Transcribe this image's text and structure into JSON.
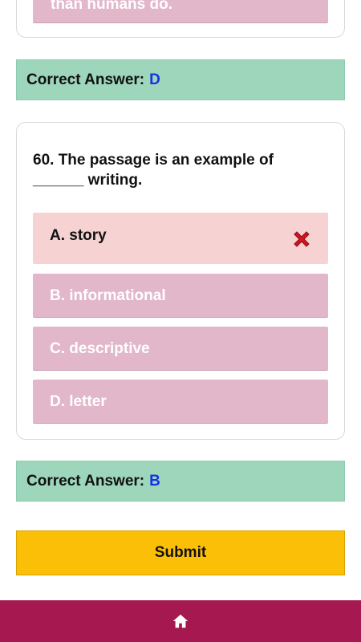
{
  "previous_question": {
    "option_partial_text": "than humans do."
  },
  "answer_bars": [
    {
      "label": "Correct Answer:",
      "letter": "D"
    },
    {
      "label": "Correct Answer:",
      "letter": "B"
    }
  ],
  "question": {
    "text_line1": "60. The passage is an example of",
    "text_line2": "______ writing.",
    "options": [
      {
        "label": "A. story",
        "state": "wrong-selected"
      },
      {
        "label": "B. informational",
        "state": "normal"
      },
      {
        "label": "C. descriptive",
        "state": "normal"
      },
      {
        "label": "D. letter",
        "state": "normal"
      }
    ]
  },
  "submit": {
    "label": "Submit"
  },
  "colors": {
    "answer_bar": "#9dd6bb",
    "answer_letter": "#1533e6",
    "option_bg": "#e2b7c9",
    "wrong_bg": "#f6d2d3",
    "submit_bg": "#fcbf08",
    "nav_bg": "#a51850",
    "wrong_icon": "#d0161e"
  },
  "icons": {
    "wrong": "x-mark-icon",
    "nav": "home-icon"
  }
}
